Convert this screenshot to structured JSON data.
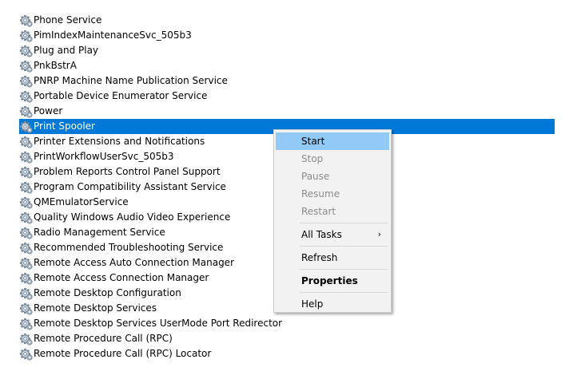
{
  "services": [
    {
      "name": "Phone Service",
      "selected": false,
      "icon": "gear-icon"
    },
    {
      "name": "PimIndexMaintenanceSvc_505b3",
      "selected": false,
      "icon": "gear-icon"
    },
    {
      "name": "Plug and Play",
      "selected": false,
      "icon": "gear-icon"
    },
    {
      "name": "PnkBstrA",
      "selected": false,
      "icon": "gear-icon"
    },
    {
      "name": "PNRP Machine Name Publication Service",
      "selected": false,
      "icon": "gear-icon"
    },
    {
      "name": "Portable Device Enumerator Service",
      "selected": false,
      "icon": "gear-icon"
    },
    {
      "name": "Power",
      "selected": false,
      "icon": "gear-icon"
    },
    {
      "name": "Print Spooler",
      "selected": true,
      "icon": "gear-icon"
    },
    {
      "name": "Printer Extensions and Notifications",
      "selected": false,
      "icon": "gear-icon"
    },
    {
      "name": "PrintWorkflowUserSvc_505b3",
      "selected": false,
      "icon": "gear-icon"
    },
    {
      "name": "Problem Reports Control Panel Support",
      "selected": false,
      "icon": "gear-icon"
    },
    {
      "name": "Program Compatibility Assistant Service",
      "selected": false,
      "icon": "gear-icon"
    },
    {
      "name": "QMEmulatorService",
      "selected": false,
      "icon": "gear-icon"
    },
    {
      "name": "Quality Windows Audio Video Experience",
      "selected": false,
      "icon": "gear-icon"
    },
    {
      "name": "Radio Management Service",
      "selected": false,
      "icon": "gear-icon"
    },
    {
      "name": "Recommended Troubleshooting Service",
      "selected": false,
      "icon": "gear-icon"
    },
    {
      "name": "Remote Access Auto Connection Manager",
      "selected": false,
      "icon": "gear-icon"
    },
    {
      "name": "Remote Access Connection Manager",
      "selected": false,
      "icon": "gear-icon"
    },
    {
      "name": "Remote Desktop Configuration",
      "selected": false,
      "icon": "gear-icon"
    },
    {
      "name": "Remote Desktop Services",
      "selected": false,
      "icon": "gear-icon"
    },
    {
      "name": "Remote Desktop Services UserMode Port Redirector",
      "selected": false,
      "icon": "gear-icon"
    },
    {
      "name": "Remote Procedure Call (RPC)",
      "selected": false,
      "icon": "gear-icon"
    },
    {
      "name": "Remote Procedure Call (RPC) Locator",
      "selected": false,
      "icon": "gear-icon"
    }
  ],
  "context_menu": {
    "start": "Start",
    "stop": "Stop",
    "pause": "Pause",
    "resume": "Resume",
    "restart": "Restart",
    "all_tasks": "All Tasks",
    "all_tasks_arrow": "›",
    "refresh": "Refresh",
    "properties": "Properties",
    "help": "Help"
  },
  "colors": {
    "selection": "#0078d7",
    "menu_hover": "#91c9f7",
    "disabled_text": "#8c8c8c",
    "menu_background": "#f2f2f2"
  }
}
